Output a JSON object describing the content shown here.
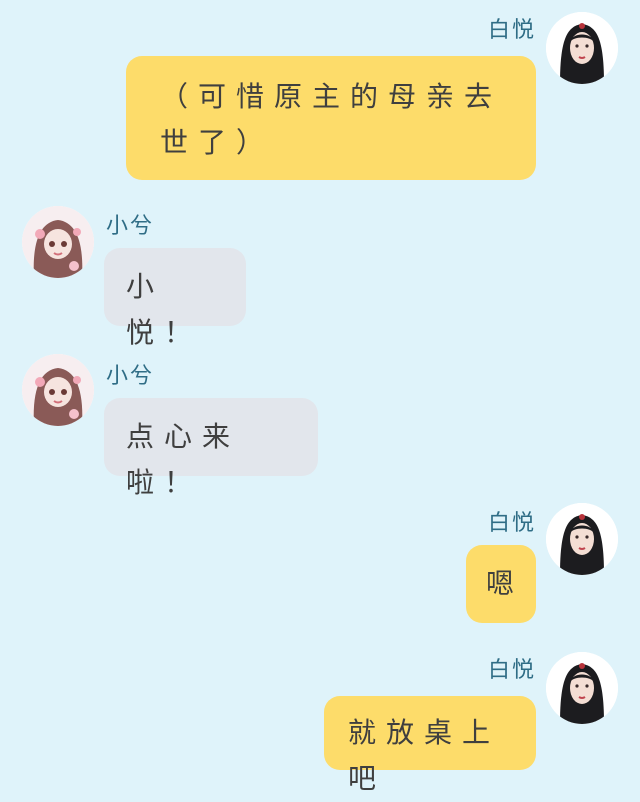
{
  "colors": {
    "background": "#dff3fa",
    "my_bubble": "#fddc6a",
    "other_bubble": "#e2e6ec",
    "name_text": "#2f6d86"
  },
  "messages": [
    {
      "sender": "白悦",
      "side": "right",
      "text": "（可惜原主的母亲去世了）",
      "avatar": "avatar-baiyue-icon"
    },
    {
      "sender": "小兮",
      "side": "left",
      "text": "小悦！",
      "avatar": "avatar-xiaoxi-icon"
    },
    {
      "sender": "小兮",
      "side": "left",
      "text": "点心来啦！",
      "avatar": "avatar-xiaoxi-icon"
    },
    {
      "sender": "白悦",
      "side": "right",
      "text": "嗯",
      "avatar": "avatar-baiyue-icon"
    },
    {
      "sender": "白悦",
      "side": "right",
      "text": "就放桌上吧",
      "avatar": "avatar-baiyue-icon"
    }
  ]
}
